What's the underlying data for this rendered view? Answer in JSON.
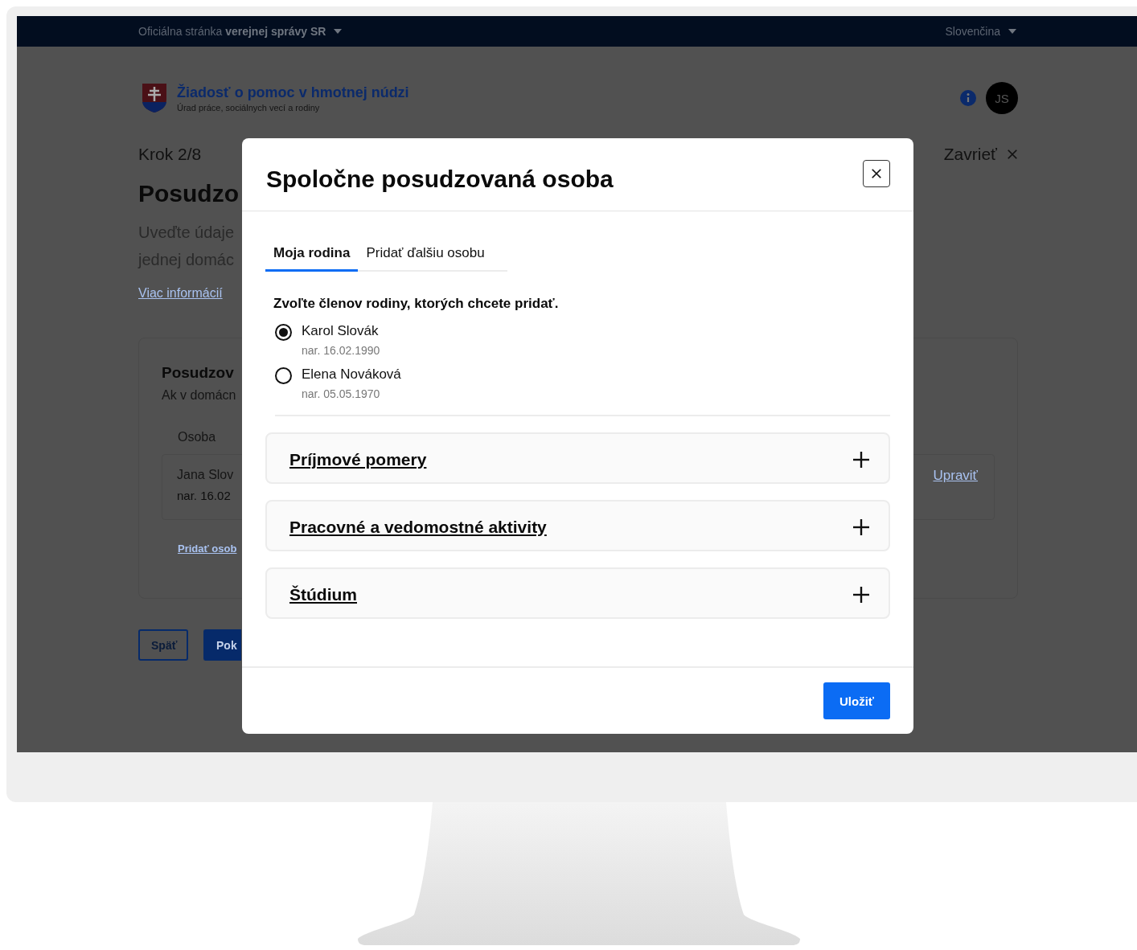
{
  "top_bar": {
    "official_text": "Oficiálna stránka **verejnej správy SR**",
    "language": "Slovenčina"
  },
  "header": {
    "title": "Žiadosť o pomoc v hmotnej núdzi",
    "subtitle": "Úrad práce, sociálnych vecí a rodiny",
    "avatar": "JS"
  },
  "page": {
    "step": "Krok 2/8",
    "close": "Zavrieť",
    "heading": "Posudzo",
    "intro_lines": [
      "Uveďte údaje",
      "jednej domác"
    ],
    "more_info_link": "Viac informácií",
    "card": {
      "title": "Posudzov",
      "description": "Ak v domácn",
      "column_label": "Osoba",
      "person": {
        "name": "Jana Slov",
        "birth": "nar. 16.02"
      },
      "edit_link": "Upraviť",
      "add_link": "Pridať osob"
    },
    "buttons": [
      {
        "label": "Späť",
        "kind": "secondary"
      },
      {
        "label": "Pok",
        "kind": "primary"
      }
    ]
  },
  "modal": {
    "title": "Spoločne posudzovaná osoba",
    "tabs": [
      {
        "label": "Moja rodina",
        "selected": true
      },
      {
        "label": "Pridať ďalšiu osobu",
        "selected": false
      }
    ],
    "prompt": "Zvoľte členov rodiny, ktorých chcete pridať.",
    "family_members": [
      {
        "name": "Karol Slovák",
        "birth": "nar. 16.02.1990",
        "selected": true
      },
      {
        "name": "Elena Nováková",
        "birth": "nar. 05.05.1970",
        "selected": false
      }
    ],
    "sections": [
      {
        "title": "Príjmové pomery",
        "expanded": false
      },
      {
        "title": "Pracovné a vedomostné aktivity",
        "expanded": false
      },
      {
        "title": "Štúdium",
        "expanded": false
      }
    ],
    "save_button": "Uložiť"
  }
}
